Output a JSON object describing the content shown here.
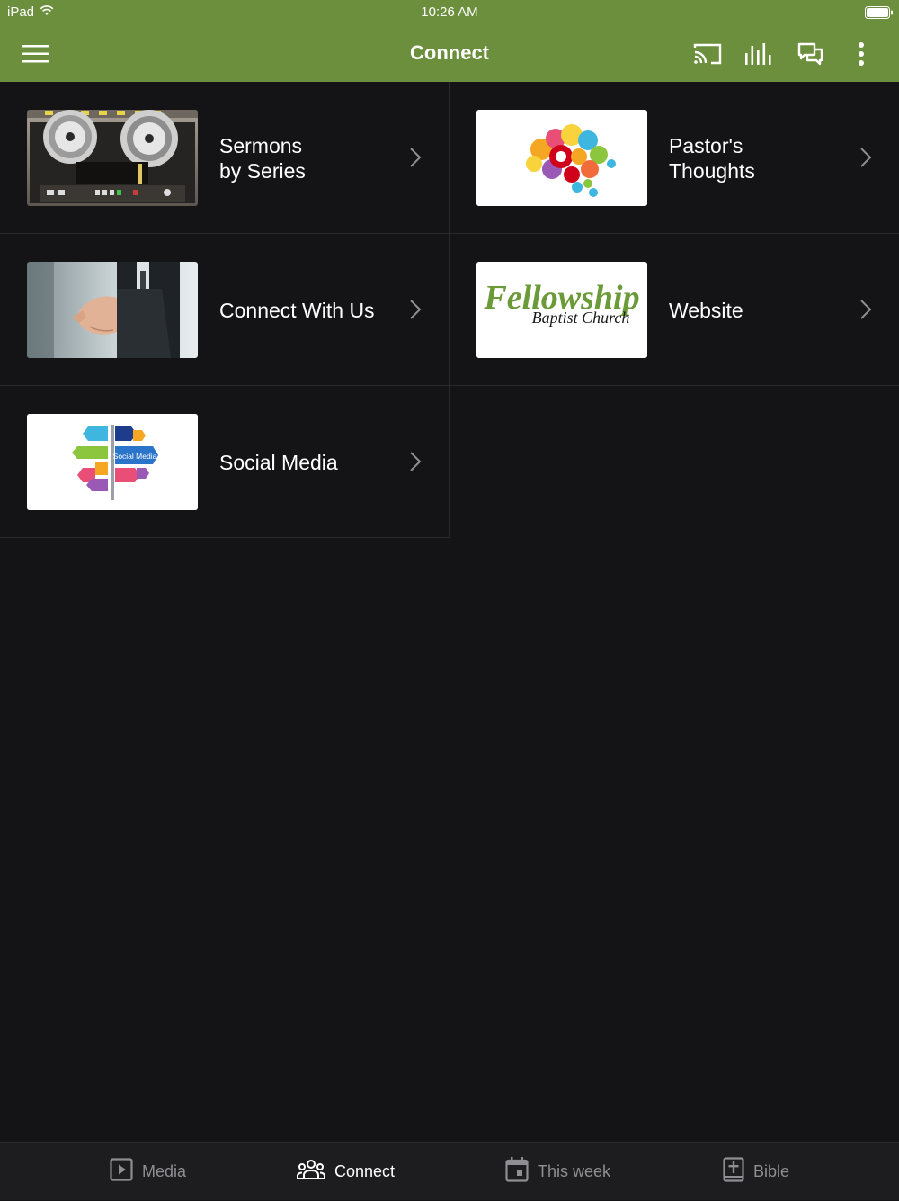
{
  "status_bar": {
    "device": "iPad",
    "time": "10:26 AM"
  },
  "nav": {
    "title": "Connect",
    "icons": [
      "menu-icon",
      "cast-icon",
      "equalizer-icon",
      "chat-icon",
      "more-vert-icon"
    ]
  },
  "items": [
    {
      "label": "Sermons\nby Series",
      "thumb": "reel-to-reel-tape-recorder"
    },
    {
      "label": "Pastor's\nThoughts",
      "thumb": "gears-brain"
    },
    {
      "label": "Connect With Us",
      "thumb": "handshake"
    },
    {
      "label": "Website",
      "thumb": "fellowship-logo",
      "logo_text": {
        "line1": "Fellowship",
        "line2": "Baptist Church"
      }
    },
    {
      "label": "Social Media",
      "thumb": "social-media-signpost",
      "sign_text": "Social Media"
    }
  ],
  "tabs": [
    {
      "label": "Media",
      "icon": "play-square-icon",
      "active": false
    },
    {
      "label": "Connect",
      "icon": "people-icon",
      "active": true
    },
    {
      "label": "This week",
      "icon": "calendar-icon",
      "active": false
    },
    {
      "label": "Bible",
      "icon": "bible-icon",
      "active": false
    }
  ],
  "colors": {
    "header": "#6b8f3c",
    "background": "#141416",
    "tab_bar": "#1d1d1f",
    "inactive_tab": "#8e8e93"
  }
}
